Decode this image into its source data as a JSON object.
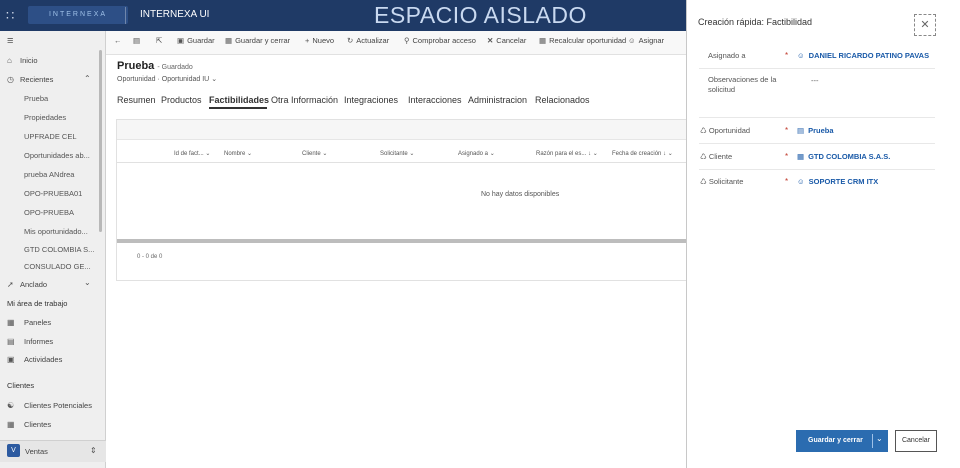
{
  "topbar": {
    "app_name": "INTERNEXA UI",
    "logo_text": "INTERNEXA",
    "environment_banner": "ESPACIO AISLADO"
  },
  "nav": {
    "home": "Inicio",
    "recent": "Recientes",
    "recent_items": [
      "Prueba",
      "Propiedades",
      "UPFRADE CEL",
      "Oportunidades ab...",
      "prueba ANdrea",
      "OPO-PRUEBA01",
      "OPO-PRUEBA",
      "Mis oportunidado...",
      "GTD COLOMBIA S...",
      "CONSULADO GE..."
    ],
    "pinned": "Anclado",
    "workspace_header": "Mi área de trabajo",
    "workspace_items": [
      "Paneles",
      "Informes",
      "Actividades"
    ],
    "clients_header": "Clientes",
    "client_items": [
      "Clientes Potenciales",
      "Clientes"
    ],
    "area_badge": "V",
    "area_name": "Ventas"
  },
  "command_bar": {
    "save": "Guardar",
    "save_close": "Guardar y cerrar",
    "new": "Nuevo",
    "refresh": "Actualizar",
    "check_access": "Comprobar acceso",
    "cancel": "Cancelar",
    "recalc": "Recalcular oportunidad",
    "assign": "Asignar"
  },
  "record": {
    "title": "Prueba",
    "saved_status": "- Guardado",
    "entity": "Oportunidad",
    "form": "Oportunidad IU"
  },
  "tabs": [
    "Resumen",
    "Productos",
    "Factibilidades",
    "Otra Información",
    "Integraciones",
    "Interacciones",
    "Administracion",
    "Relacionados"
  ],
  "grid": {
    "columns": [
      "Id de fact...",
      "Nombre",
      "Cliente",
      "Solicitante",
      "Asignado a",
      "Razón para el es...",
      "Fecha de creación"
    ],
    "empty_message": "No hay datos disponibles",
    "pager": "0 - 0 de 0"
  },
  "quick_create": {
    "title": "Creación rápida: Factibilidad",
    "fields": [
      {
        "label": "Asignado a",
        "required": "*",
        "value": "DANIEL RICARDO PATINO PAVAS",
        "icon": "user-icon"
      },
      {
        "label": "Observaciones de la solicitud",
        "required": "",
        "value": "---",
        "icon": ""
      },
      {
        "label": "Oportunidad",
        "required": "*",
        "value": "Prueba",
        "icon": "record-icon"
      },
      {
        "label": "Cliente",
        "required": "*",
        "value": "GTD COLOMBIA S.A.S.",
        "icon": "account-icon"
      },
      {
        "label": "Solicitante",
        "required": "*",
        "value": "SOPORTE CRM ITX",
        "icon": "user-icon"
      }
    ],
    "save_close": "Guardar y cerrar",
    "cancel": "Cancelar"
  }
}
